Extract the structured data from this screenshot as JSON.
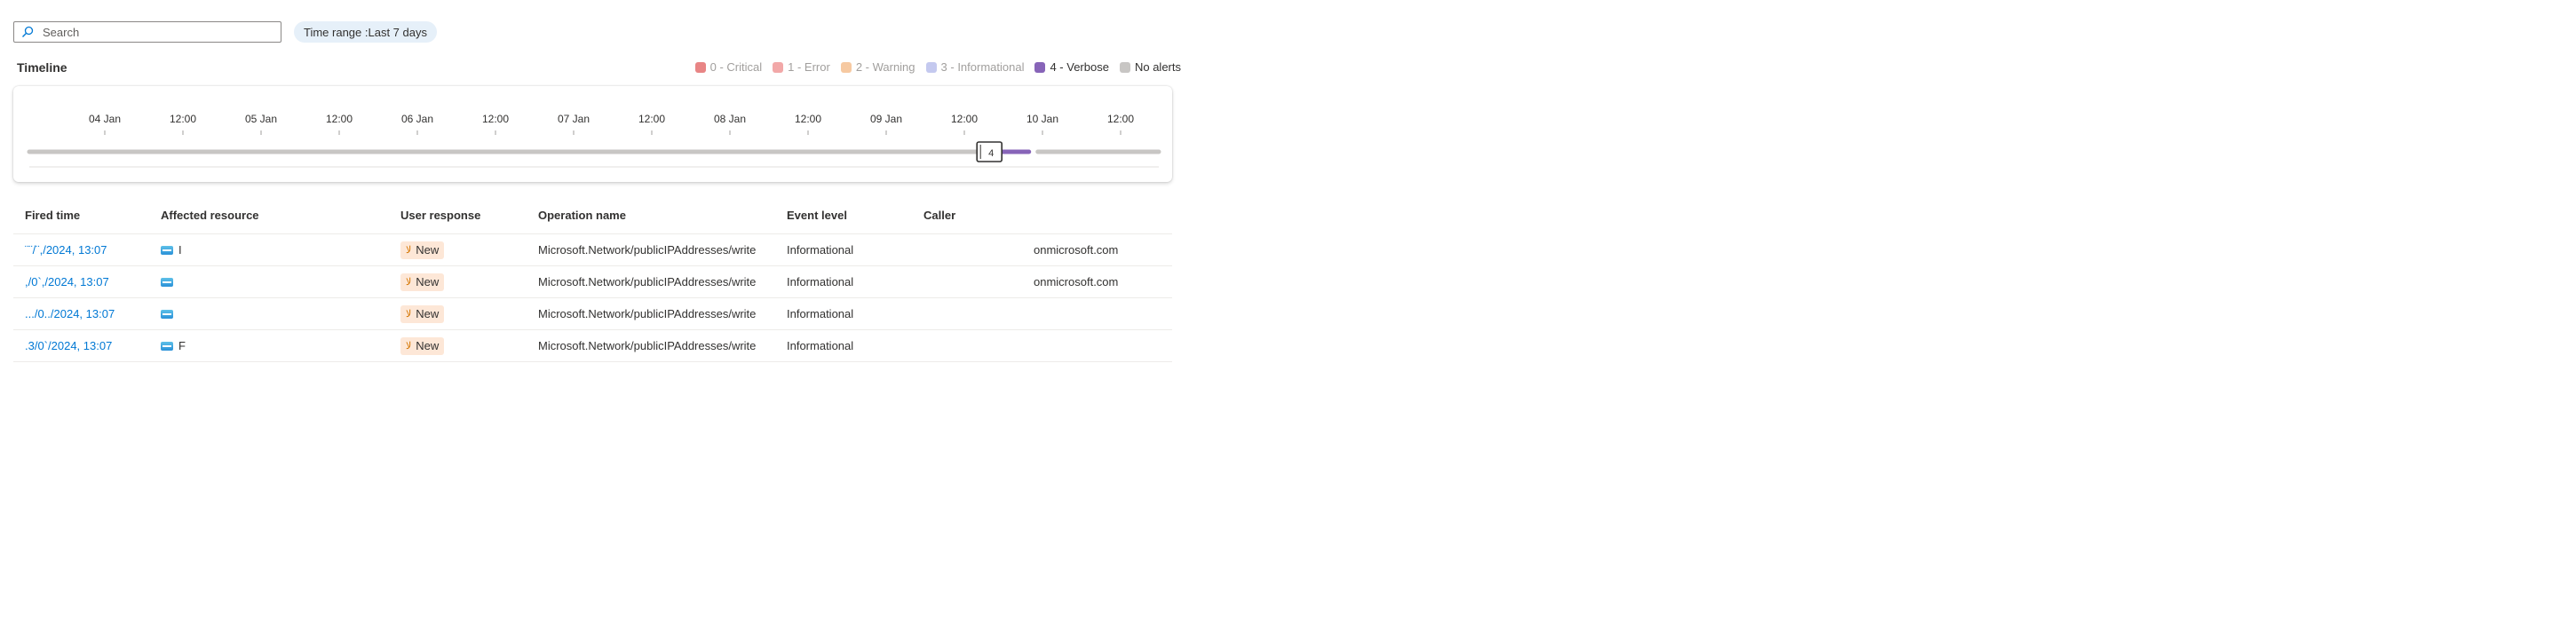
{
  "search": {
    "placeholder": "Search"
  },
  "time_range": {
    "label": "Time range : ",
    "value": "Last 7 days"
  },
  "timeline": {
    "title": "Timeline",
    "legend": [
      {
        "label": "0 - Critical",
        "color": "#e88585",
        "active": false
      },
      {
        "label": "1 - Error",
        "color": "#f2a8a8",
        "active": false
      },
      {
        "label": "2 - Warning",
        "color": "#f6c9a1",
        "active": false
      },
      {
        "label": "3 - Informational",
        "color": "#c4c9ef",
        "active": false
      },
      {
        "label": "4 - Verbose",
        "color": "#8764b8",
        "active": true
      },
      {
        "label": "No alerts",
        "color": "#c8c6c4",
        "active": true
      }
    ],
    "ticks": [
      "04 Jan",
      "12:00",
      "05 Jan",
      "12:00",
      "06 Jan",
      "12:00",
      "07 Jan",
      "12:00",
      "08 Jan",
      "12:00",
      "09 Jan",
      "12:00",
      "10 Jan",
      "12:00"
    ],
    "selection_count": "4",
    "selection_position_fraction": 0.85,
    "verbose_fraction_start": 0.85,
    "verbose_fraction_end": 0.885
  },
  "table": {
    "headers": [
      "Fired time",
      "Affected resource",
      "User response",
      "Operation name",
      "Event level",
      "Caller"
    ],
    "rows": [
      {
        "fired": "¨¨/¨,/2024, 13:07",
        "resource": "I",
        "response": "New",
        "operation": "Microsoft.Network/publicIPAddresses/write",
        "level": "Informational",
        "caller": "onmicrosoft.com"
      },
      {
        "fired": ",/0`,/2024, 13:07",
        "resource": "",
        "response": "New",
        "operation": "Microsoft.Network/publicIPAddresses/write",
        "level": "Informational",
        "caller": "onmicrosoft.com"
      },
      {
        "fired": ".../0../2024, 13:07",
        "resource": "",
        "response": "New",
        "operation": "Microsoft.Network/publicIPAddresses/write",
        "level": "Informational",
        "caller": ""
      },
      {
        "fired": ".3/0`/2024, 13:07",
        "resource": "F",
        "response": "New",
        "operation": "Microsoft.Network/publicIPAddresses/write",
        "level": "Informational",
        "caller": ""
      }
    ]
  },
  "icons": {
    "search": "search-icon",
    "resource": "public-ip-icon",
    "response": "new-alert-icon"
  }
}
